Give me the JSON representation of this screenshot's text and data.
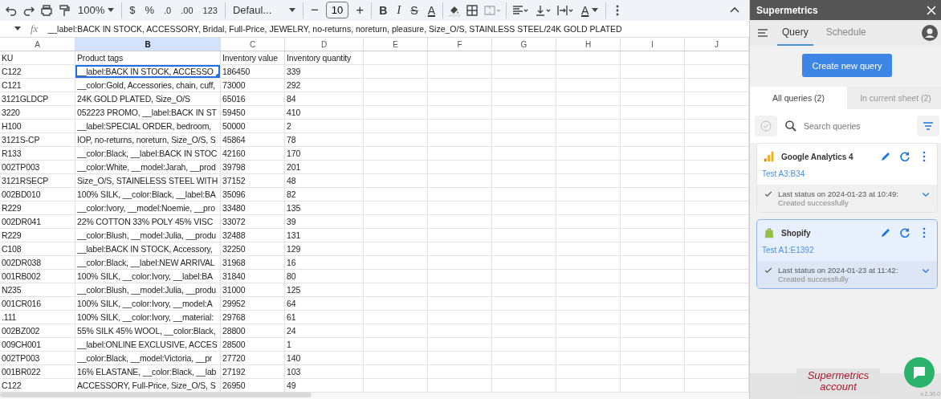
{
  "toolbar": {
    "zoom": "100%",
    "currency": "$",
    "percent": "%",
    "decimal_decrease": ".0",
    "decimal_increase": ".00",
    "number_format": "123",
    "font": "Defaul...",
    "font_minus": "−",
    "font_size": "10",
    "font_plus": "+",
    "bold": "B",
    "italic": "I",
    "strikethrough": "S",
    "text_color": "A",
    "text_rotation": "A"
  },
  "formula_bar": {
    "fx": "fx",
    "value": "__label:BACK IN STOCK, ACCESSORY, Bridal, Full-Price, JEWELRY, no-returns, noreturn, pleasure, Size_O/S, STAINLESS STEEL/24K GOLD PLATED"
  },
  "columns": [
    {
      "label": "A",
      "selected": false
    },
    {
      "label": "B",
      "selected": true
    },
    {
      "label": "C",
      "selected": false
    },
    {
      "label": "D",
      "selected": false
    },
    {
      "label": "E",
      "selected": false
    },
    {
      "label": "F",
      "selected": false
    },
    {
      "label": "G",
      "selected": false
    },
    {
      "label": "H",
      "selected": false
    },
    {
      "label": "I",
      "selected": false
    },
    {
      "label": "J",
      "selected": false
    }
  ],
  "rows": [
    {
      "cells": [
        {
          "text": "KU",
          "selected": false
        },
        {
          "text": "Product tags",
          "selected": false
        },
        {
          "text": "Inventory value",
          "selected": false
        },
        {
          "text": "Inventory quantity",
          "selected": false
        }
      ]
    },
    {
      "cells": [
        {
          "text": "C122",
          "selected": false
        },
        {
          "text": "__label:BACK IN STOCK, ACCESSO",
          "selected": true
        },
        {
          "text": "186450",
          "selected": false
        },
        {
          "text": "339",
          "selected": false
        }
      ]
    },
    {
      "cells": [
        {
          "text": "C121",
          "selected": false
        },
        {
          "text": "__color:Gold, Accessories, chain, cuff,",
          "selected": false
        },
        {
          "text": "73000",
          "selected": false
        },
        {
          "text": "292",
          "selected": false
        }
      ]
    },
    {
      "cells": [
        {
          "text": "3121GLDCP",
          "selected": false
        },
        {
          "text": "24K GOLD PLATED, Size_O/S",
          "selected": false
        },
        {
          "text": "65016",
          "selected": false
        },
        {
          "text": "84",
          "selected": false
        }
      ]
    },
    {
      "cells": [
        {
          "text": "3220",
          "selected": false
        },
        {
          "text": "052223 PROMO, __label:BACK IN ST",
          "selected": false
        },
        {
          "text": "59450",
          "selected": false
        },
        {
          "text": "410",
          "selected": false
        }
      ]
    },
    {
      "cells": [
        {
          "text": "H100",
          "selected": false
        },
        {
          "text": "__label:SPECIAL ORDER, bedroom,",
          "selected": false
        },
        {
          "text": "50000",
          "selected": false
        },
        {
          "text": "2",
          "selected": false
        }
      ]
    },
    {
      "cells": [
        {
          "text": "3121S-CP",
          "selected": false
        },
        {
          "text": "IOP, no-returns, noreturn, Size_O/S, S",
          "selected": false
        },
        {
          "text": "45864",
          "selected": false
        },
        {
          "text": "78",
          "selected": false
        }
      ]
    },
    {
      "cells": [
        {
          "text": "R133",
          "selected": false
        },
        {
          "text": "__color:Black, __label:BACK IN STOC",
          "selected": false
        },
        {
          "text": "42160",
          "selected": false
        },
        {
          "text": "170",
          "selected": false
        }
      ]
    },
    {
      "cells": [
        {
          "text": "002TP003",
          "selected": false
        },
        {
          "text": "__color:White, __model:Jarah, __prod",
          "selected": false
        },
        {
          "text": "39798",
          "selected": false
        },
        {
          "text": "201",
          "selected": false
        }
      ]
    },
    {
      "cells": [
        {
          "text": "3121RSECP",
          "selected": false
        },
        {
          "text": "Size_O/S, STAINELESS STEEL WITH",
          "selected": false
        },
        {
          "text": "37152",
          "selected": false
        },
        {
          "text": "48",
          "selected": false
        }
      ]
    },
    {
      "cells": [
        {
          "text": "002BD010",
          "selected": false
        },
        {
          "text": "100% SILK, __color:Black, __label:BA",
          "selected": false
        },
        {
          "text": "35096",
          "selected": false
        },
        {
          "text": "82",
          "selected": false
        }
      ]
    },
    {
      "cells": [
        {
          "text": "R229",
          "selected": false
        },
        {
          "text": "__color:Ivory, __model:Noemie, __pro",
          "selected": false
        },
        {
          "text": "33480",
          "selected": false
        },
        {
          "text": "135",
          "selected": false
        }
      ]
    },
    {
      "cells": [
        {
          "text": "002DR041",
          "selected": false
        },
        {
          "text": "22% COTTON 33% POLY 45% VISC",
          "selected": false
        },
        {
          "text": "33072",
          "selected": false
        },
        {
          "text": "39",
          "selected": false
        }
      ]
    },
    {
      "cells": [
        {
          "text": "R229",
          "selected": false
        },
        {
          "text": "__color:Blush, __model:Julia, __produ",
          "selected": false
        },
        {
          "text": "32488",
          "selected": false
        },
        {
          "text": "131",
          "selected": false
        }
      ]
    },
    {
      "cells": [
        {
          "text": "C108",
          "selected": false
        },
        {
          "text": "__label:BACK IN STOCK, Accessory,",
          "selected": false
        },
        {
          "text": "32250",
          "selected": false
        },
        {
          "text": "129",
          "selected": false
        }
      ]
    },
    {
      "cells": [
        {
          "text": "002DR038",
          "selected": false
        },
        {
          "text": "__color:Black, __label:NEW ARRIVAL",
          "selected": false
        },
        {
          "text": "31968",
          "selected": false
        },
        {
          "text": "16",
          "selected": false
        }
      ]
    },
    {
      "cells": [
        {
          "text": "001RB002",
          "selected": false
        },
        {
          "text": "100% SILK, __color:Ivory, __label:BA",
          "selected": false
        },
        {
          "text": "31840",
          "selected": false
        },
        {
          "text": "80",
          "selected": false
        }
      ]
    },
    {
      "cells": [
        {
          "text": "N235",
          "selected": false
        },
        {
          "text": "__color:Blush, __model:Julia, __produ",
          "selected": false
        },
        {
          "text": "31000",
          "selected": false
        },
        {
          "text": "125",
          "selected": false
        }
      ]
    },
    {
      "cells": [
        {
          "text": "001CR016",
          "selected": false
        },
        {
          "text": "100% SILK, __color:Ivory, __model:A",
          "selected": false
        },
        {
          "text": "29952",
          "selected": false
        },
        {
          "text": "64",
          "selected": false
        }
      ]
    },
    {
      "cells": [
        {
          "text": ".111",
          "selected": false
        },
        {
          "text": "100% SILK, __color:Ivory, __material:",
          "selected": false
        },
        {
          "text": "29768",
          "selected": false
        },
        {
          "text": "61",
          "selected": false
        }
      ]
    },
    {
      "cells": [
        {
          "text": "002BZ002",
          "selected": false
        },
        {
          "text": "55% SILK 45% WOOL, __color:Black,",
          "selected": false
        },
        {
          "text": "28800",
          "selected": false
        },
        {
          "text": "24",
          "selected": false
        }
      ]
    },
    {
      "cells": [
        {
          "text": "009CH001",
          "selected": false
        },
        {
          "text": "__label:ONLINE EXCLUSIVE, ACCES",
          "selected": false
        },
        {
          "text": "28500",
          "selected": false
        },
        {
          "text": "1",
          "selected": false
        }
      ]
    },
    {
      "cells": [
        {
          "text": "002TP003",
          "selected": false
        },
        {
          "text": "__color:Black, __model:Victoria, __pr",
          "selected": false
        },
        {
          "text": "27720",
          "selected": false
        },
        {
          "text": "140",
          "selected": false
        }
      ]
    },
    {
      "cells": [
        {
          "text": "001BR022",
          "selected": false
        },
        {
          "text": "16% ELASTANE, __color:Black, __lab",
          "selected": false
        },
        {
          "text": "27192",
          "selected": false
        },
        {
          "text": "103",
          "selected": false
        }
      ]
    },
    {
      "cells": [
        {
          "text": "C122",
          "selected": false
        },
        {
          "text": "ACCESSORY, Full-Price, Size_O/S, S",
          "selected": false
        },
        {
          "text": "26950",
          "selected": false
        },
        {
          "text": "49",
          "selected": false
        }
      ]
    }
  ],
  "sidebar": {
    "title": "Supermetrics",
    "tabs": [
      {
        "label": "Query",
        "selected": true
      },
      {
        "label": "Schedule",
        "selected": false
      }
    ],
    "create_button": "Create new query",
    "filter_tabs": [
      {
        "label": "All queries (2)",
        "selected": true
      },
      {
        "label": "In current sheet (2)",
        "selected": false
      }
    ],
    "search": {
      "placeholder": "Search queries"
    },
    "queries": [
      {
        "kind": "analytics",
        "name": "Google Analytics 4",
        "range": "Test A3:B34",
        "status": "Last status on 2024-01-23 at 10:49:",
        "detail": "Created successfully",
        "selected": false
      },
      {
        "kind": "shop",
        "name": "Shopify",
        "range": "Test A1:E1392",
        "status": "Last status on 2024-01-23 at 11:42:",
        "detail": "Created successfully",
        "selected": true
      }
    ],
    "version": "v.2.30.0"
  },
  "caption": "Supermetrics account"
}
